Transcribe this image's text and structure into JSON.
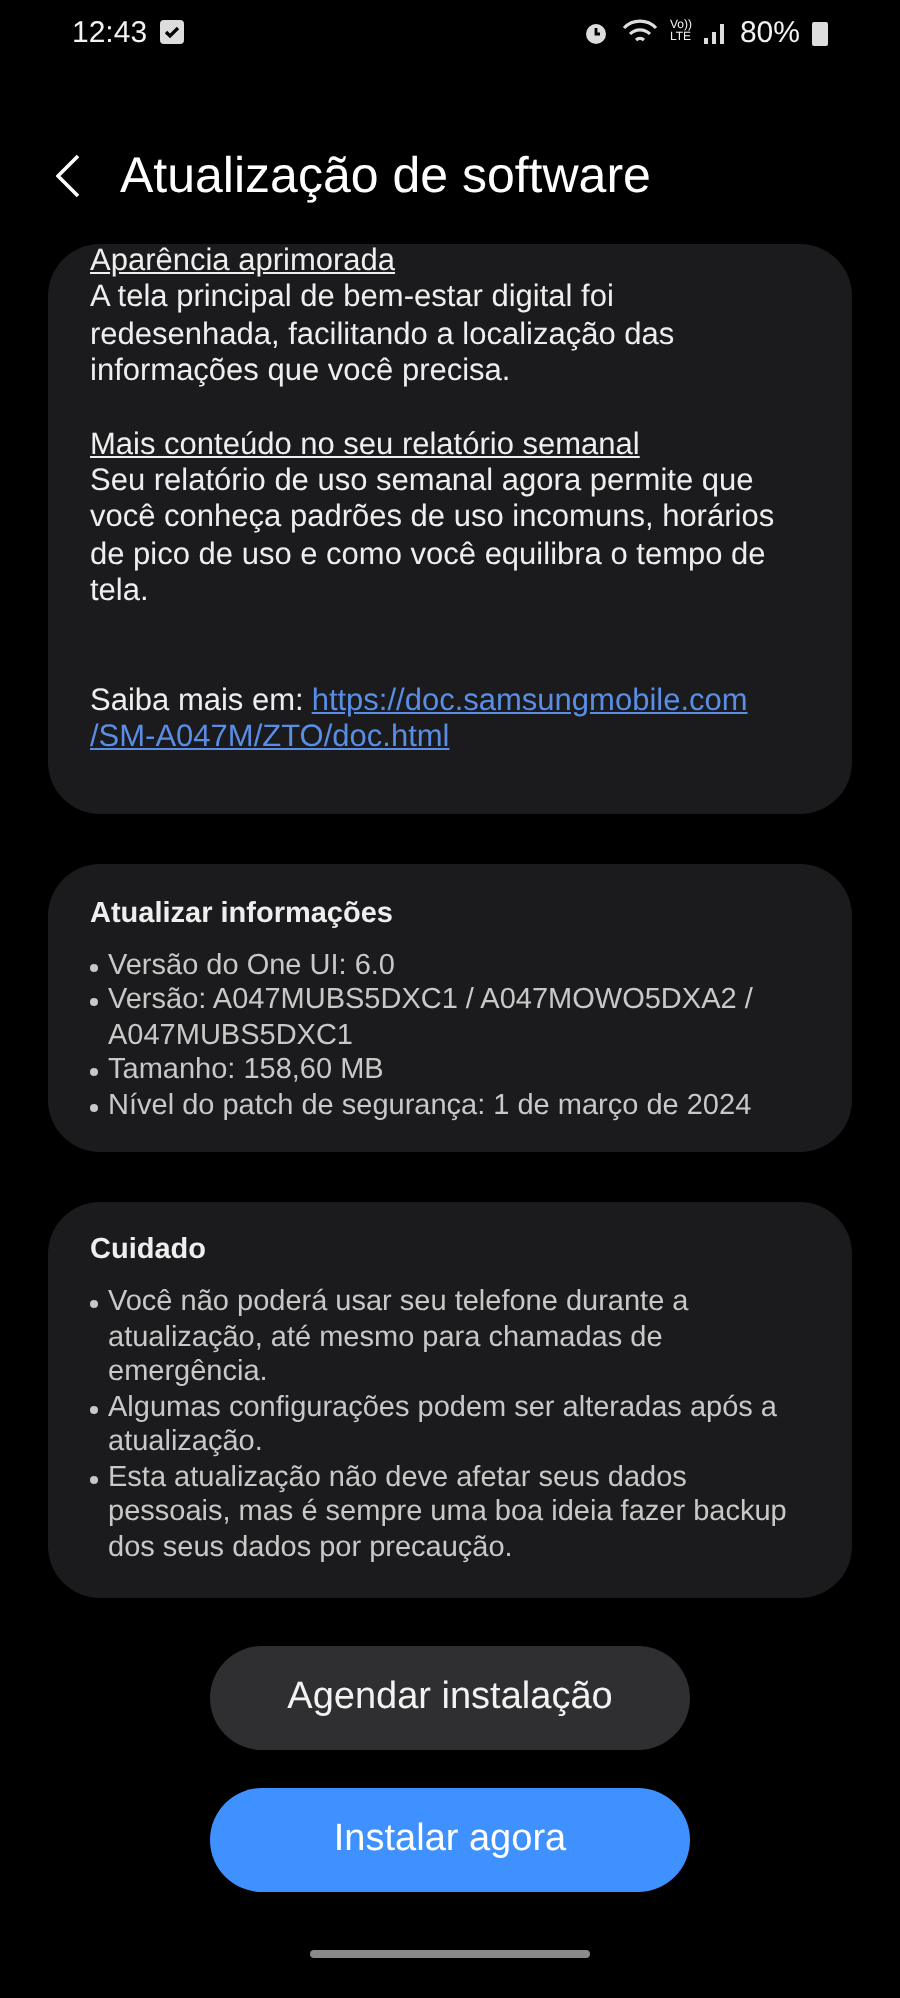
{
  "status_bar": {
    "time": "12:43",
    "network_label": [
      "Vo))",
      "LTE"
    ],
    "battery": "80%"
  },
  "header": {
    "title": "Atualização de software"
  },
  "whats_new": {
    "sections": [
      {
        "heading": "Aparência aprimorada",
        "body": "A tela principal de bem-estar digital foi redesenhada, facilitando a localização das informações que você precisa."
      },
      {
        "heading": "Mais conteúdo no seu relatório semanal",
        "body": "Seu relatório de uso semanal agora permite que você conheça padrões de uso incomuns, horários de pico de uso e como você equilibra o tempo de tela."
      }
    ],
    "more_info": {
      "label": "Saiba mais em:",
      "link_lines": [
        "https://doc.samsungmobile.com",
        "/SM-A047M/ZTO/doc.html"
      ]
    }
  },
  "update_info": {
    "title": "Atualizar informações",
    "items": [
      "Versão do One UI: 6.0",
      "Versão: A047MUBS5DXC1 / A047MOWO5DXA2 / A047MUBS5DXC1",
      "Tamanho: 158,60 MB",
      "Nível do patch de segurança: 1 de março de 2024"
    ]
  },
  "caution": {
    "title": "Cuidado",
    "items": [
      "Você não poderá usar seu telefone durante a atualização, até mesmo para chamadas de emergência.",
      "Algumas configurações podem ser alteradas após a atualização.",
      "Esta atualização não deve afetar seus dados pessoais, mas é sempre uma boa ideia fazer backup dos seus dados por precaução."
    ]
  },
  "buttons": [
    {
      "label": "Agendar instalação",
      "kind": "secondary"
    },
    {
      "label": "Instalar agora",
      "kind": "primary"
    }
  ]
}
